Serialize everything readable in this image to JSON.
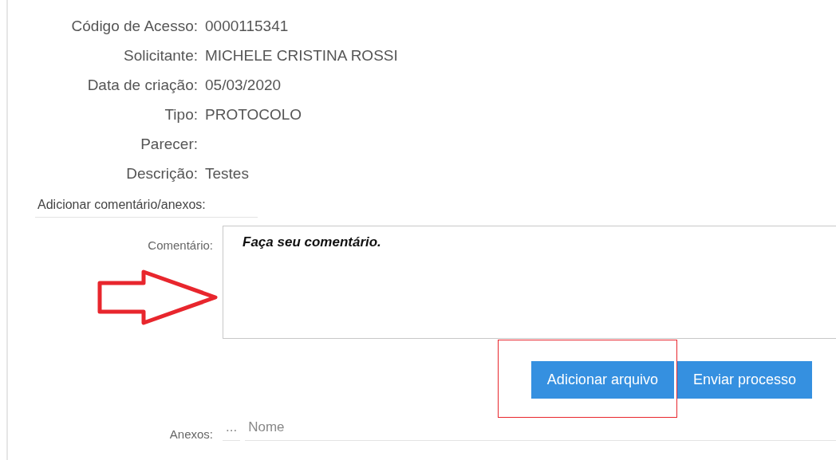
{
  "fields": [
    {
      "label": "Código de Acesso:",
      "value": "0000115341"
    },
    {
      "label": "Solicitante:",
      "value": "MICHELE CRISTINA ROSSI"
    },
    {
      "label": "Data de criação:",
      "value": "05/03/2020"
    },
    {
      "label": "Tipo:",
      "value": "PROTOCOLO"
    },
    {
      "label": "Parecer:"
    },
    {
      "label": "Descrição:",
      "value": "Testes"
    }
  ],
  "comment_section": {
    "title": "Adicionar comentário/anexos:",
    "comment_label": "Comentário:",
    "comment_placeholder": "Faça seu comentário.",
    "buttons": [
      {
        "label": "Adicionar arquivo",
        "highlighted": true
      },
      {
        "label": "Enviar processo",
        "highlighted": false
      }
    ]
  },
  "attachments": {
    "label": "Anexos:",
    "columns": [
      "...",
      "Nome"
    ]
  }
}
